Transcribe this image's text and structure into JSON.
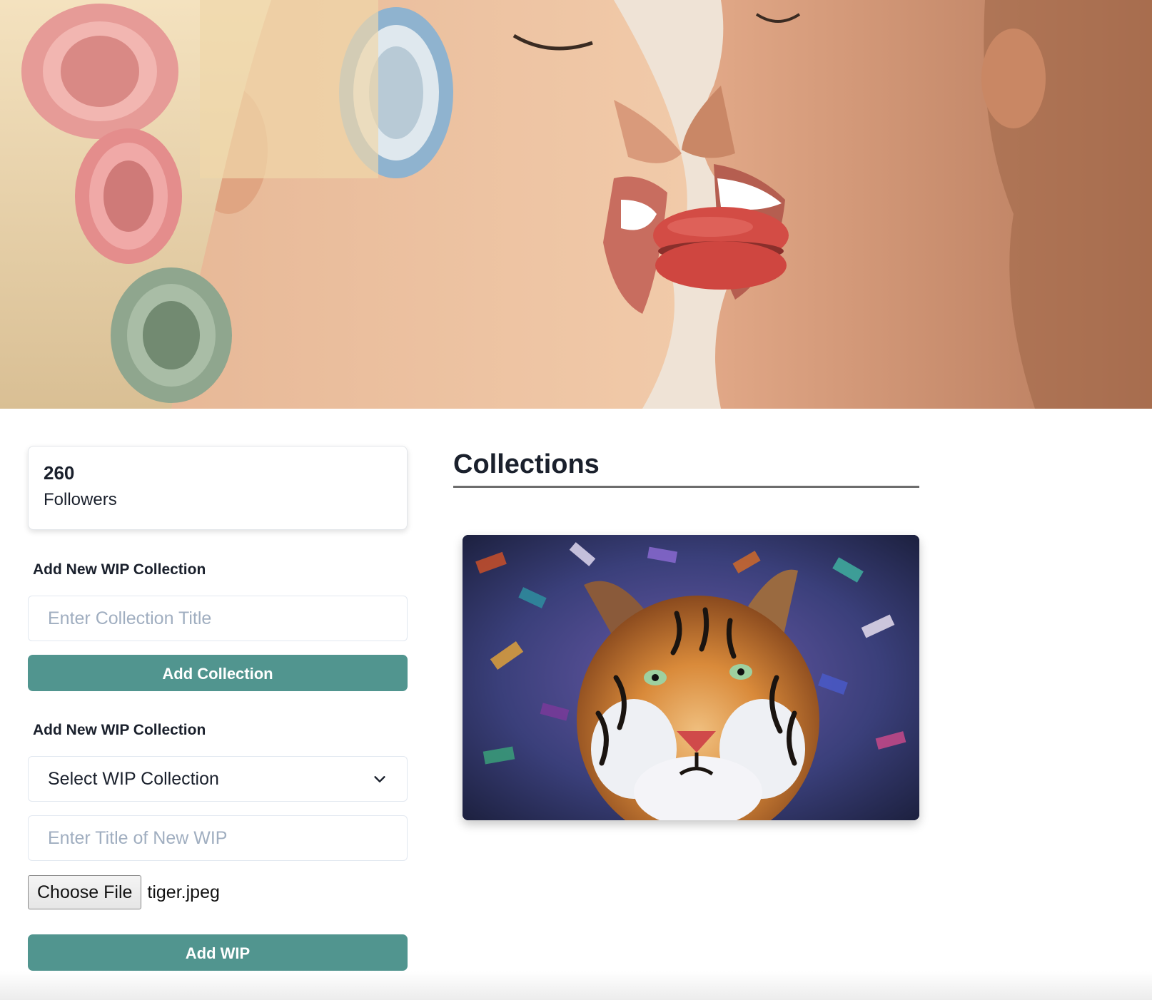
{
  "banner": {
    "image": "cover-photo-two-women-sharing-macaron"
  },
  "profile": {
    "followers_count": "260",
    "followers_label": "Followers"
  },
  "add_collection": {
    "label": "Add New WIP Collection",
    "title_placeholder": "Enter Collection Title",
    "button_label": "Add Collection"
  },
  "add_wip": {
    "label": "Add New WIP Collection",
    "select_value": "Select WIP Collection",
    "title_placeholder": "Enter Title of New WIP",
    "file_button_label": "Choose File",
    "file_name": "tiger.jpeg",
    "button_label": "Add WIP"
  },
  "collections": {
    "heading": "Collections",
    "items": [
      {
        "image": "tiger-painting"
      }
    ]
  },
  "colors": {
    "accent": "#51958f",
    "text": "#1a202c",
    "placeholder": "#a0aec0"
  }
}
